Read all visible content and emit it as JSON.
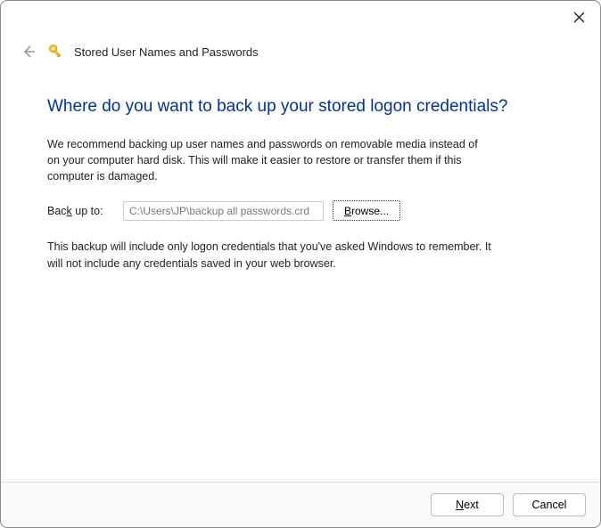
{
  "header": {
    "title": "Stored User Names and Passwords"
  },
  "content": {
    "heading": "Where do you want to back up your stored logon credentials?",
    "para1": "We recommend backing up user names and passwords on removable media instead of on your computer hard disk. This will make it easier to restore or transfer them if this computer is damaged.",
    "backup_label": "Back up to:",
    "backup_path": "C:\\Users\\JP\\backup all passwords.crd",
    "browse_label": "Browse...",
    "para2": "This backup will include only logon credentials that you've asked Windows to remember. It will not include any credentials saved in your web browser."
  },
  "footer": {
    "next_label": "Next",
    "cancel_label": "Cancel"
  }
}
